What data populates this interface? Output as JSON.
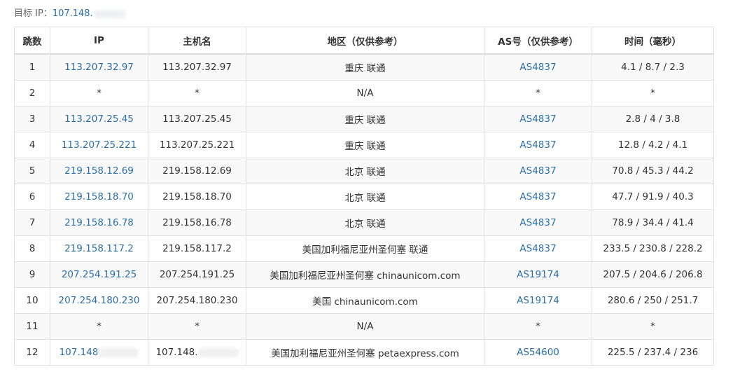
{
  "target": {
    "label": "目标 IP：",
    "ip": "107.148."
  },
  "headers": {
    "hop": "跳数",
    "ip": "IP",
    "hostname": "主机名",
    "region": "地区（仅供参考）",
    "asn": "AS号（仅供参考）",
    "time": "时间（毫秒）"
  },
  "rows": [
    {
      "hop": "1",
      "ip": "113.207.32.97",
      "hostname": "113.207.32.97",
      "region": "重庆 联通",
      "asn": "AS4837",
      "time": "4.1 / 8.7 / 2.3"
    },
    {
      "hop": "2",
      "ip": "*",
      "hostname": "*",
      "region": "N/A",
      "asn": "*",
      "time": "*"
    },
    {
      "hop": "3",
      "ip": "113.207.25.45",
      "hostname": "113.207.25.45",
      "region": "重庆 联通",
      "asn": "AS4837",
      "time": "2.8 / 4 / 3.8"
    },
    {
      "hop": "4",
      "ip": "113.207.25.221",
      "hostname": "113.207.25.221",
      "region": "重庆 联通",
      "asn": "AS4837",
      "time": "12.8 / 4.2 / 4.1"
    },
    {
      "hop": "5",
      "ip": "219.158.12.69",
      "hostname": "219.158.12.69",
      "region": "北京 联通",
      "asn": "AS4837",
      "time": "70.8 / 45.3 / 44.2"
    },
    {
      "hop": "6",
      "ip": "219.158.18.70",
      "hostname": "219.158.18.70",
      "region": "北京 联通",
      "asn": "AS4837",
      "time": "47.7 / 91.9 / 40.3"
    },
    {
      "hop": "7",
      "ip": "219.158.16.78",
      "hostname": "219.158.16.78",
      "region": "北京 联通",
      "asn": "AS4837",
      "time": "78.9 / 34.4 / 41.4"
    },
    {
      "hop": "8",
      "ip": "219.158.117.2",
      "hostname": "219.158.117.2",
      "region": "美国加利福尼亚州圣何塞 联通",
      "asn": "AS4837",
      "time": "233.5 / 230.8 / 228.2"
    },
    {
      "hop": "9",
      "ip": "207.254.191.25",
      "hostname": "207.254.191.25",
      "region": "美国加利福尼亚州圣何塞 chinaunicom.com",
      "asn": "AS19174",
      "time": "207.5 / 204.6 / 206.8"
    },
    {
      "hop": "10",
      "ip": "207.254.180.230",
      "hostname": "207.254.180.230",
      "region": "美国 chinaunicom.com",
      "asn": "AS19174",
      "time": "280.6 / 250 / 251.7"
    },
    {
      "hop": "11",
      "ip": "*",
      "hostname": "*",
      "region": "N/A",
      "asn": "*",
      "time": "*"
    },
    {
      "hop": "12",
      "ip": "107.148",
      "hostname": "107.148.",
      "region": "美国加利福尼亚州圣何塞 petaexpress.com",
      "asn": "AS54600",
      "time": "225.5 / 237.4 / 236"
    }
  ],
  "colors": {
    "link": "#2a6fa8",
    "border": "#e1e1e1",
    "stripe": "#f9f9f9"
  }
}
